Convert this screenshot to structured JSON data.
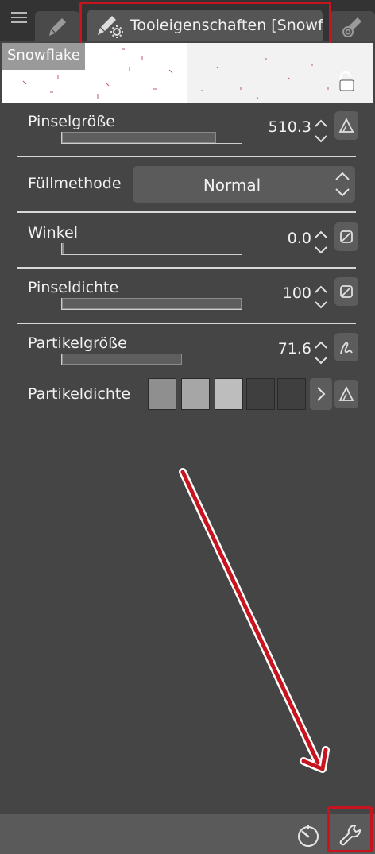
{
  "topbar": {
    "menu_icon": "hamburger-menu-icon",
    "tabs": [
      {
        "icon": "brush-icon"
      },
      {
        "icon": "tool-settings-icon",
        "title": "Tooleigenschaften [Snowfl"
      },
      {
        "icon": "spiral-brush-icon"
      }
    ]
  },
  "preview": {
    "brush_name": "Snowflake",
    "lock_icon": "unlock-icon"
  },
  "properties": {
    "brush_size": {
      "label": "Pinselgröße",
      "value": "510.3",
      "fill": 0.86,
      "button_icon": "pressure-triangle-icon"
    },
    "fill_mode": {
      "label": "Füllmethode",
      "value": "Normal"
    },
    "angle": {
      "label": "Winkel",
      "value": "0.0",
      "fill": 0.0,
      "button_icon": "disabled-slash-icon"
    },
    "brush_density": {
      "label": "Pinseldichte",
      "value": "100",
      "fill": 1.0,
      "button_icon": "disabled-slash-icon"
    },
    "particle_size": {
      "label": "Partikelgröße",
      "value": "71.6",
      "fill": 0.67,
      "button_icon": "pen-stroke-icon"
    },
    "particle_density": {
      "label": "Partikeldichte",
      "levels": 5,
      "active_levels": 3,
      "button_icon": "pressure-triangle-icon"
    }
  },
  "colors": {
    "highlight": "#c8141e",
    "background": "#454545",
    "topbar": "#333333",
    "swatch_1": "#8f8f8f",
    "swatch_2": "#a6a6a6",
    "swatch_3": "#bdbdbd",
    "swatch_off": "#3f3f3f"
  },
  "bottombar": {
    "icons": [
      "reset-timer-icon",
      "wrench-settings-icon"
    ]
  }
}
